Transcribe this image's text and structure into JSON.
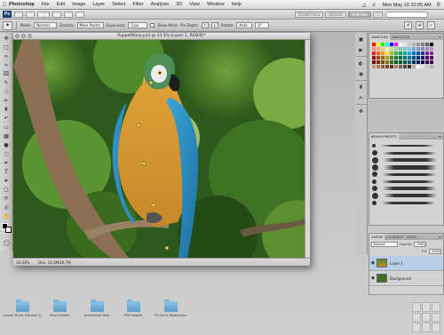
{
  "menubar": {
    "apple_icon": "apple-icon",
    "app_name": "Photoshop",
    "items": [
      "File",
      "Edit",
      "Image",
      "Layer",
      "Select",
      "Filter",
      "Analysis",
      "3D",
      "View",
      "Window",
      "Help"
    ],
    "clock": "Mon May 10 10:05 AM"
  },
  "appbar": {
    "logo": "Ps",
    "workspaces": [
      "ESSENTIALS",
      "DESIGN",
      "PAINTING"
    ],
    "active_workspace": "PAINTING",
    "more": "»",
    "cs_live": "CS Live"
  },
  "options": {
    "mode_label": "Mode:",
    "mode_value": "Normal",
    "density_label": "Density:",
    "density_value": "More Points",
    "expansion_label": "Expansion:",
    "expansion_value": "2 px",
    "show_mesh_label": "Show Mesh",
    "pin_depth_label": "Pin Depth:",
    "rotate_label": "Rotate:",
    "rotate_value": "Auto",
    "angle_value": "0°"
  },
  "document": {
    "title": "PuppetWarp.psd @ 33.3% (Layer 1, RGB/8)*",
    "zoom": "33.33%",
    "doc_size": "Doc: 14.3M/16.7M"
  },
  "panels": {
    "swatches_tabs": [
      "SWATCHES",
      "NAVIGATOR"
    ],
    "brush_tabs": [
      "BRUSH PRESETS"
    ],
    "layers_tabs": [
      "LAYERS",
      "CHANNELS",
      "PATHS"
    ],
    "blend_mode": "Normal",
    "opacity_label": "Opacity:",
    "opacity_value": "100%",
    "fill_label": "Fill:",
    "fill_value": "100%",
    "layers": [
      {
        "name": "Layer 1"
      },
      {
        "name": "Background"
      }
    ],
    "swatch_colors": [
      "#ff0000",
      "#ffff00",
      "#00ff00",
      "#00ffff",
      "#0000ff",
      "#ff00ff",
      "#ffffff",
      "#e6e6e6",
      "#cccccc",
      "#b3b3b3",
      "#999999",
      "#808080",
      "#666666",
      "#000000",
      "#f7977a",
      "#f9ad81",
      "#fdc68a",
      "#fff79a",
      "#c4df9b",
      "#a2d39c",
      "#82ca9d",
      "#7bcdc8",
      "#6ecff6",
      "#7ea7d8",
      "#8493ca",
      "#8882be",
      "#a187be",
      "#bc8dbf",
      "#ed1c24",
      "#f26522",
      "#f7941d",
      "#fff200",
      "#8dc63f",
      "#39b54a",
      "#00a651",
      "#00a99d",
      "#00aeef",
      "#0072bc",
      "#0054a6",
      "#2e3192",
      "#662d91",
      "#92278f",
      "#9e0b0f",
      "#a0410d",
      "#a36209",
      "#aba000",
      "#598527",
      "#1a7b30",
      "#007236",
      "#00746b",
      "#0076a3",
      "#004b80",
      "#003471",
      "#1b1464",
      "#440e62",
      "#630460",
      "#790000",
      "#7b2e00",
      "#7d4900",
      "#827b00",
      "#406618",
      "#005e20",
      "#005826",
      "#005952",
      "#005b7f",
      "#003663",
      "#002157",
      "#0d004c",
      "#32004b",
      "#4b0049",
      "#c69c6d",
      "#a67c52",
      "#8c6239",
      "#754c24",
      "#603913",
      "#998675",
      "#736357",
      "#534741",
      "#362f2d",
      "#c7b299",
      "#ffffff",
      "#e6e6e6",
      "#cccccc",
      "#b3b3b3"
    ]
  },
  "desktop": {
    "folders": [
      "Lesson Finals (Version 2)",
      "Start Folders",
      "Screenshot Files",
      "PSD Images",
      "PS Quick Bookmarks"
    ]
  }
}
